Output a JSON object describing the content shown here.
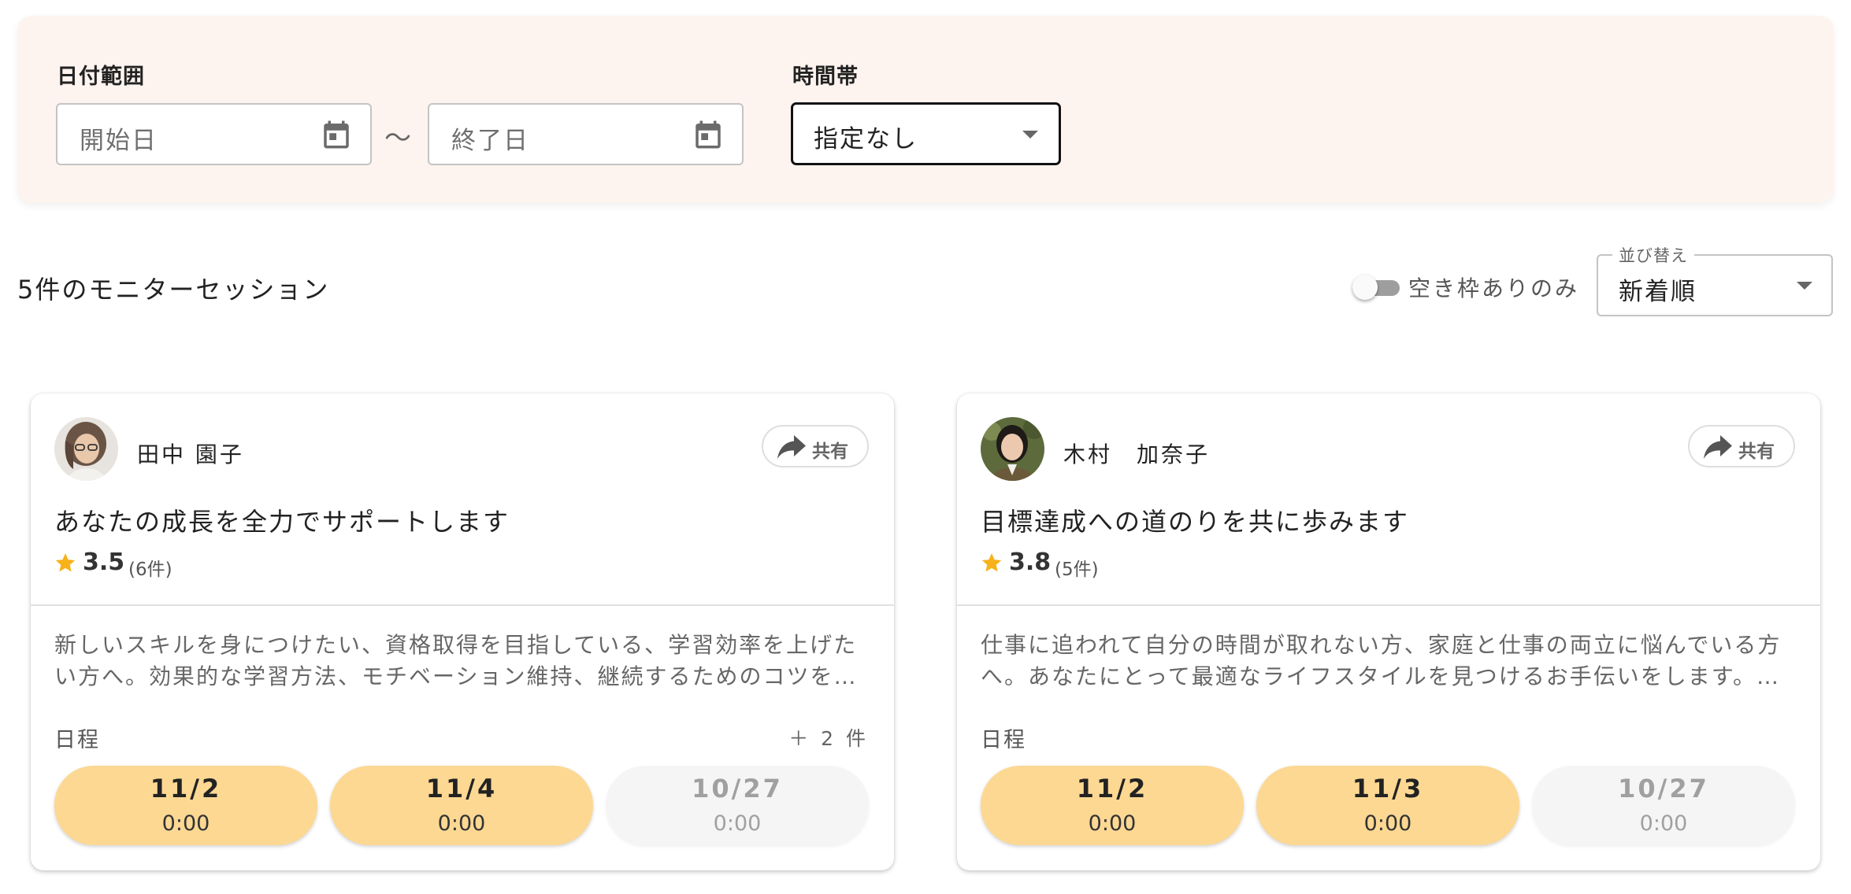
{
  "filters": {
    "date_range_label": "日付範囲",
    "start_placeholder": "開始日",
    "end_placeholder": "終了日",
    "separator": "〜",
    "time_slot_label": "時間帯",
    "time_slot_value": "指定なし"
  },
  "results": {
    "count_title": "5件のモニターセッション",
    "availability_toggle": {
      "label": "空き枠ありのみ",
      "on": false
    },
    "sort": {
      "legend": "並び替え",
      "value": "新着順"
    }
  },
  "cards": [
    {
      "host_name": "田中 園子",
      "share_label": "共有",
      "title": "あなたの成長を全力でサポートします",
      "rating": "3.5",
      "review_count": "(6件)",
      "description": "新しいスキルを身につけたい、資格取得を目指している、学習効率を上げたい方へ。効果的な学習方法、モチベーション維持、継続するためのコツを…",
      "schedule_label": "日程",
      "more_label": "＋ 2 件",
      "slots": [
        {
          "date": "11/2",
          "time": "0:00",
          "available": true
        },
        {
          "date": "11/4",
          "time": "0:00",
          "available": true
        },
        {
          "date": "10/27",
          "time": "0:00",
          "available": false
        }
      ]
    },
    {
      "host_name": "木村　加奈子",
      "share_label": "共有",
      "title": "目標達成への道のりを共に歩みます",
      "rating": "3.8",
      "review_count": "(5件)",
      "description": "仕事に追われて自分の時間が取れない方、家庭と仕事の両立に悩んでいる方へ。あなたにとって最適なライフスタイルを見つけるお手伝いをします。ス…",
      "schedule_label": "日程",
      "more_label": "",
      "slots": [
        {
          "date": "11/2",
          "time": "0:00",
          "available": true
        },
        {
          "date": "11/3",
          "time": "0:00",
          "available": true
        },
        {
          "date": "10/27",
          "time": "0:00",
          "available": false
        }
      ]
    }
  ],
  "colors": {
    "panel_bg": "#fdf3ef",
    "slot_available": "#fdd893",
    "slot_unavailable": "#f5f5f5",
    "star": "#f7b21a"
  },
  "icons": {
    "date_picker": "calendar-icon",
    "select_caret": "caret-down-icon",
    "share": "share-arrow-icon",
    "rating": "star-icon"
  }
}
